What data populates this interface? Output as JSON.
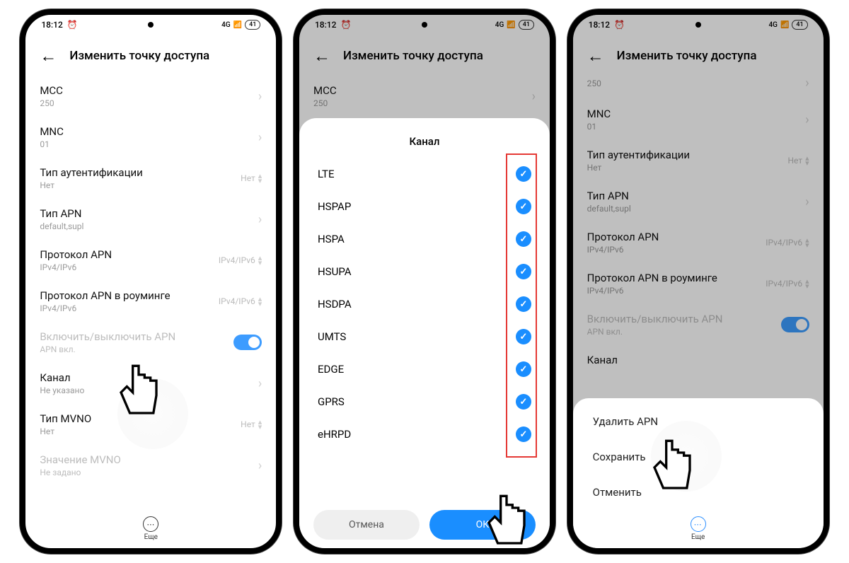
{
  "status": {
    "time": "18:12",
    "alarm_indicator": "⏰",
    "signal_label": "4G",
    "battery": "41"
  },
  "header": {
    "title": "Изменить точку доступа"
  },
  "rows": {
    "mcc": {
      "label": "MCC",
      "value": "250"
    },
    "mnc": {
      "label": "MNC",
      "value": "01"
    },
    "auth": {
      "label": "Тип аутентификации",
      "value": "Нет",
      "right": "Нет"
    },
    "apn_type": {
      "label": "Тип APN",
      "value": "default,supl"
    },
    "apn_protocol": {
      "label": "Протокол APN",
      "value": "IPv4/IPv6",
      "right": "IPv4/IPv6"
    },
    "apn_protocol_roaming": {
      "label": "Протокол APN в роуминге",
      "value": "IPv4/IPv6",
      "right": "IPv4/IPv6"
    },
    "apn_toggle": {
      "label": "Включить/выключить APN",
      "value": "APN вкл."
    },
    "bearer": {
      "label": "Канал",
      "value": "Не указано"
    },
    "mvno_type": {
      "label": "Тип MVNO",
      "value": "Нет",
      "right": "Нет"
    },
    "mvno_value": {
      "label": "Значение MVNO",
      "value": "Не задано"
    }
  },
  "more_label": "Еще",
  "dialog": {
    "title": "Канал",
    "options": [
      "LTE",
      "HSPAP",
      "HSPA",
      "HSUPA",
      "HSDPA",
      "UMTS",
      "EDGE",
      "GPRS",
      "eHRPD"
    ],
    "cancel": "Отмена",
    "ok": "ОК"
  },
  "menu": {
    "delete": "Удалить APN",
    "save": "Сохранить",
    "cancel": "Отменить"
  },
  "phone3": {
    "mcc_top_value": "250"
  }
}
